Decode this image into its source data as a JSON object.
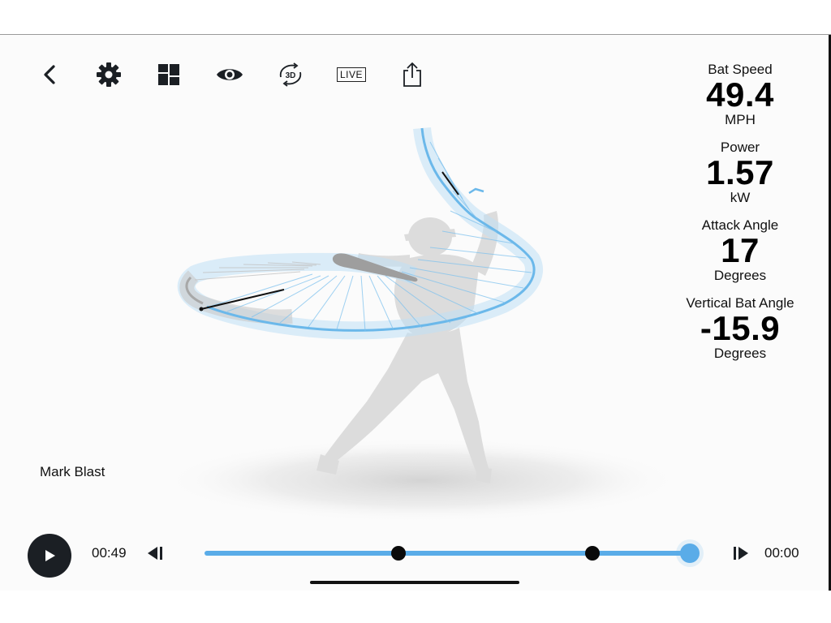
{
  "toolbar": {
    "icons": [
      "back-icon",
      "gear-icon",
      "dashboard-grid-icon",
      "eye-icon",
      "rotate-3d-icon",
      "live-icon",
      "share-icon"
    ],
    "rotate_label": "3D",
    "live_label": "LIVE"
  },
  "metrics": [
    {
      "label": "Bat Speed",
      "value": "49.4",
      "unit": "MPH"
    },
    {
      "label": "Power",
      "value": "1.57",
      "unit": "kW"
    },
    {
      "label": "Attack Angle",
      "value": "17",
      "unit": "Degrees"
    },
    {
      "label": "Vertical Bat Angle",
      "value": "-15.9",
      "unit": "Degrees"
    }
  ],
  "player": {
    "name": "Mark Blast"
  },
  "playback": {
    "elapsed": "00:49",
    "remaining": "00:00",
    "markers": [
      0.4,
      0.8
    ],
    "progress": 1.0
  },
  "colors": {
    "accent": "#5aace8",
    "dark": "#1b1f24",
    "silhouette": "#dcdcdc"
  }
}
